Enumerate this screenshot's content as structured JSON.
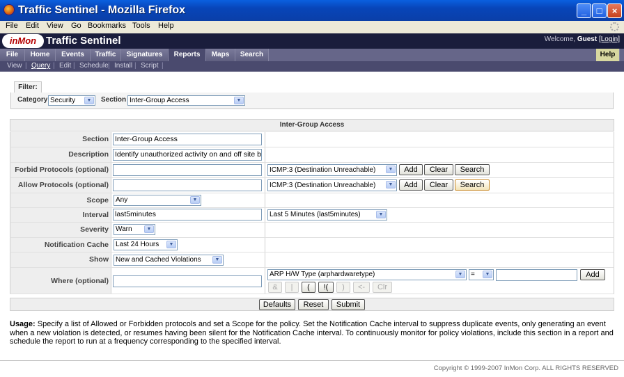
{
  "window": {
    "title": "Traffic Sentinel - Mozilla Firefox"
  },
  "menu": [
    "File",
    "Edit",
    "View",
    "Go",
    "Bookmarks",
    "Tools",
    "Help"
  ],
  "app": {
    "logo": "inMon",
    "title": "Traffic Sentinel",
    "welcome_prefix": "Welcome,",
    "user": "Guest",
    "login": "[Login]"
  },
  "tabs": [
    "File",
    "Home",
    "Events",
    "Traffic",
    "Signatures",
    "Reports",
    "Maps",
    "Search"
  ],
  "active_tab": "Reports",
  "help": "Help",
  "subtabs": [
    "View",
    "Query",
    "Edit",
    "Schedule",
    "Install",
    "Script"
  ],
  "filter": {
    "label": "Filter:",
    "category_label": "Category",
    "category_value": "Security",
    "section_label": "Section",
    "section_value": "Inter-Group Access"
  },
  "form": {
    "header": "Inter-Group Access",
    "section": {
      "label": "Section",
      "value": "Inter-Group Access"
    },
    "description": {
      "label": "Description",
      "value": "Identify unauthorized activity on and off site b"
    },
    "forbid": {
      "label": "Forbid Protocols (optional)",
      "value": "",
      "select": "ICMP:3 (Destination Unreachable)"
    },
    "allow": {
      "label": "Allow Protocols (optional)",
      "value": "",
      "select": "ICMP:3 (Destination Unreachable)"
    },
    "scope": {
      "label": "Scope",
      "value": "Any"
    },
    "interval": {
      "label": "Interval",
      "value": "last5minutes",
      "select": "Last 5 Minutes (last5minutes)"
    },
    "severity": {
      "label": "Severity",
      "value": "Warn"
    },
    "notification": {
      "label": "Notification Cache",
      "value": "Last 24 Hours"
    },
    "show": {
      "label": "Show",
      "value": "New and Cached Violations"
    },
    "where": {
      "label": "Where (optional)",
      "value": "",
      "field": "ARP H/W Type (arphardwaretype)",
      "op": "=",
      "operand": ""
    },
    "buttons": {
      "add": "Add",
      "clear": "Clear",
      "search": "Search"
    },
    "where_ops": [
      "&",
      "|",
      "(",
      "!(",
      ")",
      "<-",
      "Clr"
    ]
  },
  "actions": {
    "defaults": "Defaults",
    "reset": "Reset",
    "submit": "Submit"
  },
  "usage": {
    "label": "Usage:",
    "text": "Specify a list of Allowed or Forbidden protocols and set a Scope for the policy. Set the Notification Cache interval to suppress duplicate events, only generating an event when a new violation is detected, or resumes having been silent for the Notification Cache interval. To continuously monitor for policy violations, include this section in a report and schedule the report to run at a frequency corresponding to the specified interval."
  },
  "copyright": "Copyright © 1999-2007 InMon Corp. ALL RIGHTS RESERVED"
}
